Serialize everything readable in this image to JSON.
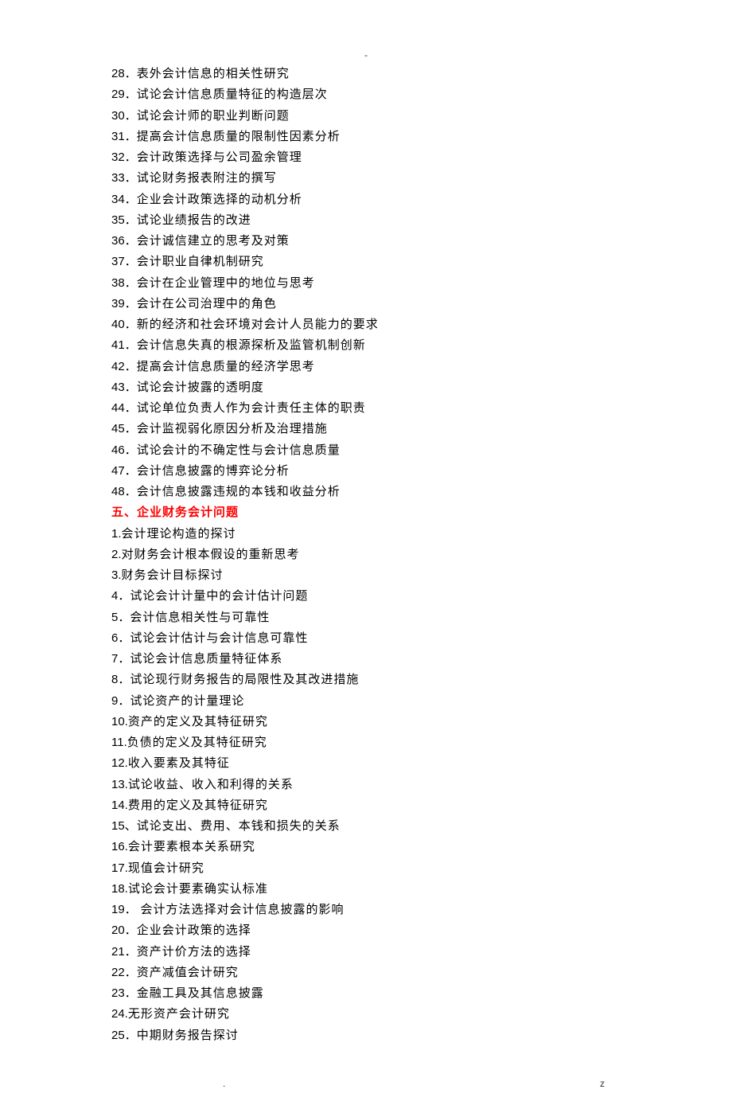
{
  "topMark": "-",
  "sectionA": [
    {
      "num": "28．",
      "text": "表外会计信息的相关性研究"
    },
    {
      "num": "29．",
      "text": "试论会计信息质量特征的构造层次"
    },
    {
      "num": "30．",
      "text": "试论会计师的职业判断问题"
    },
    {
      "num": "31．",
      "text": "提高会计信息质量的限制性因素分析"
    },
    {
      "num": "32．",
      "text": "会计政策选择与公司盈余管理"
    },
    {
      "num": "33．",
      "text": "试论财务报表附注的撰写"
    },
    {
      "num": "34．",
      "text": "企业会计政策选择的动机分析"
    },
    {
      "num": "35．",
      "text": "试论业绩报告的改进"
    },
    {
      "num": "36．",
      "text": "会计诚信建立的思考及对策"
    },
    {
      "num": "37．",
      "text": "会计职业自律机制研究"
    },
    {
      "num": "38．",
      "text": "会计在企业管理中的地位与思考"
    },
    {
      "num": "39．",
      "text": "会计在公司治理中的角色"
    },
    {
      "num": "40．",
      "text": "新的经济和社会环境对会计人员能力的要求"
    },
    {
      "num": "41．",
      "text": "会计信息失真的根源探析及监管机制创新"
    },
    {
      "num": "42．",
      "text": "提高会计信息质量的经济学思考"
    },
    {
      "num": "43．",
      "text": "试论会计披露的透明度"
    },
    {
      "num": "44．",
      "text": "试论单位负责人作为会计责任主体的职责"
    },
    {
      "num": "45．",
      "text": "会计监视弱化原因分析及治理措施"
    },
    {
      "num": "46．",
      "text": "试论会计的不确定性与会计信息质量"
    },
    {
      "num": "47．",
      "text": "会计信息披露的博弈论分析"
    },
    {
      "num": "48．",
      "text": "会计信息披露违规的本钱和收益分析"
    }
  ],
  "heading": "五、企业财务会计问题",
  "sectionB": [
    {
      "num": "1.",
      "text": "会计理论构造的探讨"
    },
    {
      "num": "2.",
      "text": "对财务会计根本假设的重新思考"
    },
    {
      "num": "3.",
      "text": "财务会计目标探讨"
    },
    {
      "num": "4．",
      "text": "试论会计计量中的会计估计问题"
    },
    {
      "num": "5．",
      "text": "会计信息相关性与可靠性"
    },
    {
      "num": "6．",
      "text": "试论会计估计与会计信息可靠性"
    },
    {
      "num": "7．",
      "text": "试论会计信息质量特征体系"
    },
    {
      "num": "8．",
      "text": "试论现行财务报告的局限性及其改进措施"
    },
    {
      "num": "9．",
      "text": "试论资产的计量理论"
    },
    {
      "num": "10.",
      "text": "资产的定义及其特征研究"
    },
    {
      "num": "11.",
      "text": "负债的定义及其特征研究"
    },
    {
      "num": "12.",
      "text": "收入要素及其特征"
    },
    {
      "num": "13.",
      "text": "试论收益、收入和利得的关系"
    },
    {
      "num": "14.",
      "text": "费用的定义及其特征研究"
    },
    {
      "num": "15、",
      "text": "试论支出、费用、本钱和损失的关系"
    },
    {
      "num": "16.",
      "text": "会计要素根本关系研究"
    },
    {
      "num": "17.",
      "text": "现值会计研究"
    },
    {
      "num": "18.",
      "text": "试论会计要素确实认标准"
    },
    {
      "num": "19．",
      "text": " 会计方法选择对会计信息披露的影响"
    },
    {
      "num": "20．",
      "text": "企业会计政策的选择"
    },
    {
      "num": "21．",
      "text": "资产计价方法的选择"
    },
    {
      "num": "22．",
      "text": "资产减值会计研究"
    },
    {
      "num": "23．",
      "text": "金融工具及其信息披露"
    },
    {
      "num": "24.",
      "text": "无形资产会计研究"
    },
    {
      "num": "25．",
      "text": "中期财务报告探讨"
    }
  ],
  "footerLeft": ".",
  "footerRight": "z"
}
